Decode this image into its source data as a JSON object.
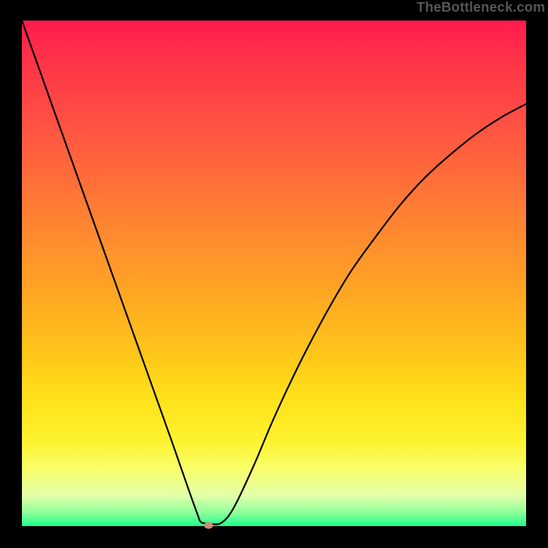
{
  "attribution": "TheBottleneck.com",
  "chart_data": {
    "type": "line",
    "title": "",
    "xlabel": "",
    "ylabel": "",
    "xlim": [
      0,
      1
    ],
    "ylim": [
      0,
      1
    ],
    "legend": false,
    "grid": false,
    "axes_visible": false,
    "background_gradient": {
      "top_color": "#ff1a4d",
      "bottom_color": "#1aff88",
      "mid_color": "#ffe21a"
    },
    "series": [
      {
        "name": "curve",
        "color": "#000000",
        "x": [
          0.0,
          0.05,
          0.1,
          0.15,
          0.2,
          0.25,
          0.3,
          0.33,
          0.348,
          0.355,
          0.37,
          0.395,
          0.42,
          0.46,
          0.5,
          0.55,
          0.6,
          0.65,
          0.7,
          0.75,
          0.8,
          0.85,
          0.9,
          0.95,
          1.0
        ],
        "y": [
          1.0,
          0.86,
          0.72,
          0.58,
          0.44,
          0.3,
          0.16,
          0.074,
          0.024,
          0.008,
          0.005,
          0.006,
          0.036,
          0.12,
          0.214,
          0.32,
          0.415,
          0.5,
          0.57,
          0.635,
          0.69,
          0.735,
          0.775,
          0.808,
          0.835
        ]
      }
    ],
    "marker": {
      "name": "optimum",
      "x": 0.37,
      "y": 0.002,
      "color": "#cc8a7d",
      "shape": "ellipse"
    }
  }
}
